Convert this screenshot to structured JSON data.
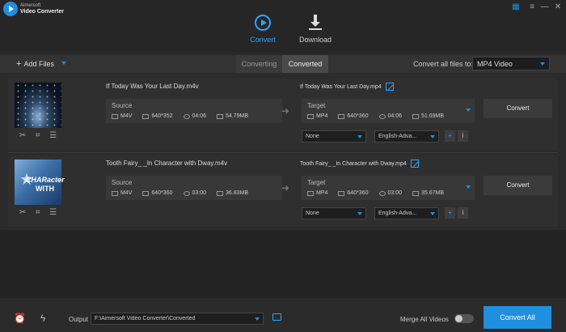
{
  "app": {
    "brand_line1": "Aimersoft",
    "brand_line2": "Video Converter"
  },
  "modes": {
    "convert": "Convert",
    "download": "Download"
  },
  "toolbar": {
    "add_files": "Add Files",
    "tab_converting": "Converting",
    "tab_converted": "Converted",
    "convert_all_label": "Convert all files to:",
    "convert_all_value": "MP4 Video"
  },
  "files": [
    {
      "source_name": "If Today Was Your Last Day.m4v",
      "source_title": "Source",
      "source_format": "M4V",
      "source_resolution": "640*352",
      "source_duration": "04:06",
      "source_size": "54.79MB",
      "target_name": "If Today Was Your Last Day.mp4",
      "target_title": "Target",
      "target_format": "MP4",
      "target_resolution": "640*360",
      "target_duration": "04:06",
      "target_size": "51.69MB",
      "subtitle": "None",
      "audio": "English-Adva...",
      "convert_label": "Convert"
    },
    {
      "source_name": "Tooth Fairy_ _In Character with Dway.m4v",
      "source_title": "Source",
      "source_format": "M4V",
      "source_resolution": "640*360",
      "source_duration": "03:00",
      "source_size": "36.83MB",
      "target_name": "Tooth Fairy_ _In Character with Dway.mp4",
      "target_title": "Target",
      "target_format": "MP4",
      "target_resolution": "640*360",
      "target_duration": "03:00",
      "target_size": "35.67MB",
      "subtitle": "None",
      "audio": "English-Adva...",
      "convert_label": "Convert"
    }
  ],
  "thumb2_text": {
    "line1": "CHARacter",
    "line2": "WITH"
  },
  "bottom": {
    "output_label": "Output",
    "output_path": "F:\\Aimersoft Video Converter\\Converted",
    "merge_label": "Merge All Videos",
    "merge_on": false,
    "convert_all": "Convert All"
  },
  "colors": {
    "accent": "#1f8fe0",
    "background": "#2b2b2b"
  },
  "icons": [
    "play-logo-icon",
    "gift-icon",
    "menu-icon",
    "minimize-icon",
    "close-icon",
    "convert-icon",
    "download-icon",
    "plus-icon",
    "scissors-icon",
    "crop-icon",
    "effects-icon",
    "film-icon",
    "resolution-icon",
    "clock-icon",
    "folder-icon",
    "arrow-right-icon",
    "edit-icon",
    "add-subtitle-icon",
    "info-icon",
    "alarm-icon",
    "lightning-icon",
    "folder-open-icon"
  ]
}
